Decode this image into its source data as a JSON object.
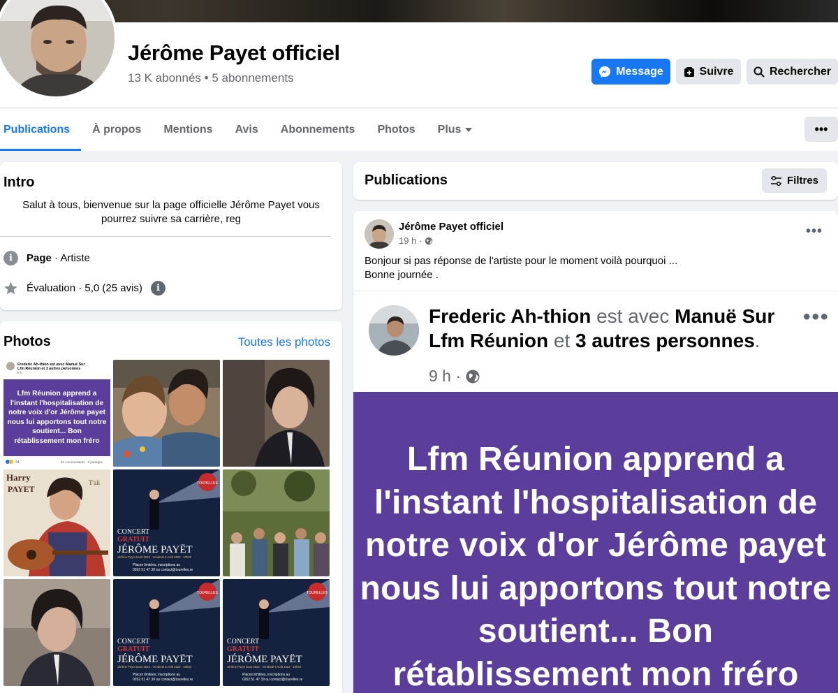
{
  "page": {
    "title": "Jérôme Payet officiel",
    "followers": "13 K abonnés",
    "following": "5 abonnements",
    "separator": "•"
  },
  "actions": {
    "message": "Message",
    "follow": "Suivre",
    "search": "Rechercher"
  },
  "tabs": [
    {
      "label": "Publications",
      "active": true
    },
    {
      "label": "À propos"
    },
    {
      "label": "Mentions"
    },
    {
      "label": "Avis"
    },
    {
      "label": "Abonnements"
    },
    {
      "label": "Photos"
    },
    {
      "label": "Plus"
    }
  ],
  "intro": {
    "title": "Intro",
    "bio": "Salut à tous, bienvenue sur la page officielle Jérôme Payet vous pourrez suivre sa carrière, reg",
    "category_label": "Page",
    "category_value": "· Artiste",
    "rating": "Évaluation · 5,0 (25 avis)"
  },
  "photos": {
    "title": "Photos",
    "see_all": "Toutes les photos",
    "thumb_text": {
      "mini_post_line1": "Frederic Ah-thion est avec Manuë Sur",
      "mini_post_line2": "Lfm Réunion et 3 autres personnes",
      "mini_post_time": "9 h",
      "mini_post_body": "Lfm Réunion apprend a l'instant l'hospitalisation de notre voix d'or Jérôme payet nous lui apportons tout notre soutient... Bon rétablissement mon fréro",
      "mini_post_reactions": "94",
      "mini_post_comments": "50 commentaires · 8 partages",
      "album_name": "Harry",
      "album_name_2": "PAYET",
      "album_tag": "T'ali",
      "poster_line1": "CONCERT",
      "poster_line2": "GRATUIT",
      "poster_name": "JÉRÔME PAYËT",
      "poster_sub": "Jérôme Payet tours 2022 · Vendredi 5 Août 2022 - 16h30",
      "poster_small": "Places limitées, inscriptions au",
      "poster_contact": "0262 51 47 39 ou contact@tourelles.re",
      "poster_badge": "TOURELLES"
    }
  },
  "publications": {
    "title": "Publications",
    "filters": "Filtres"
  },
  "post": {
    "author": "Jérôme Payet officiel",
    "time": "19 h ·",
    "text_line1": "Bonjour si pas réponse de l'artiste pour le moment voilà pourquoi ...",
    "text_line2": "Bonne journée .",
    "shared": {
      "author": "Frederic Ah-thion",
      "with": "est avec",
      "tagged": "Manuë Sur Lfm Réunion",
      "and": "et",
      "others": "3 autres personnes",
      "period": ".",
      "time": "9 h ·",
      "body": "Lfm Réunion apprend a l'instant l'hospitalisation de notre voix d'or Jérôme payet nous lui apportons tout notre soutient... Bon rétablissement mon fréro"
    }
  },
  "colors": {
    "accent": "#1877f2",
    "purple_bg": "#5b3d9c",
    "secondary_bg": "#e4e6eb",
    "muted_text": "#65676b"
  }
}
